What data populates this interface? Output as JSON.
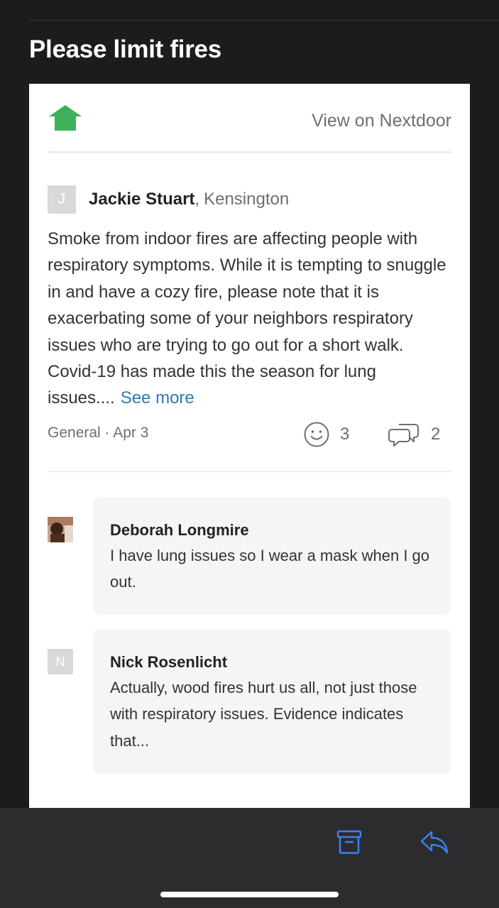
{
  "email": {
    "subject": "Please limit fires"
  },
  "header": {
    "logo_icon": "nextdoor-house-icon",
    "brand_color": "#3fb15b",
    "view_link": "View on Nextdoor"
  },
  "post": {
    "author_initial": "J",
    "author_name": "Jackie Stuart",
    "separator": ",",
    "neighborhood": "Kensington",
    "body": "Smoke from indoor fires are affecting people with respiratory symptoms. While it is tempting to snuggle in and have a cozy fire, please note that it is exacerbating some of your neighbors respiratory issues who are trying to go out for a short walk. Covid-19 has made this the season for lung issues....",
    "see_more": "See more",
    "link_color": "#2f7bab",
    "category_date": "General · Apr 3",
    "reaction_icon": "smiley-icon",
    "reaction_count": "3",
    "comment_icon": "speech-bubbles-icon",
    "comment_count": "2"
  },
  "comments": [
    {
      "avatar_type": "photo",
      "author": "Deborah Longmire",
      "text": "I have lung issues so I wear a mask when I go out."
    },
    {
      "avatar_type": "initial",
      "avatar_initial": "N",
      "author": "Nick Rosenlicht",
      "text": "Actually, wood fires hurt us all, not just those with respiratory issues. Evidence indicates that..."
    }
  ],
  "toolbar": {
    "archive_icon": "archive-box-icon",
    "reply_icon": "reply-arrow-icon",
    "icon_color": "#3a82f7"
  }
}
